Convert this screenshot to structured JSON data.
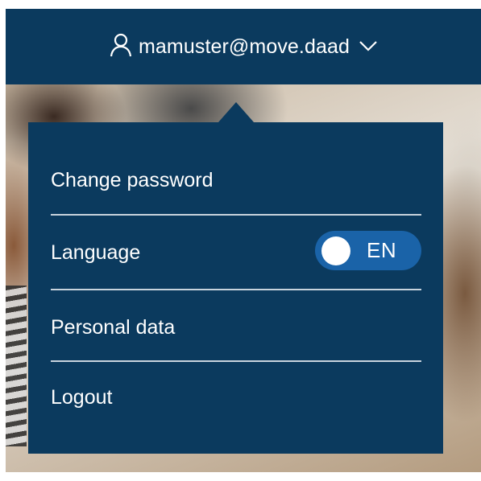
{
  "header": {
    "user_email": "mamuster@move.daad",
    "icons": {
      "user": "user-outline-icon",
      "chevron": "chevron-down-icon"
    }
  },
  "menu": {
    "items": [
      {
        "label": "Change password"
      },
      {
        "label": "Language",
        "toggle_value": "EN"
      },
      {
        "label": "Personal data"
      },
      {
        "label": "Logout"
      }
    ]
  },
  "colors": {
    "header_bg": "#0b3a5e",
    "menu_bg": "#0b3a5e",
    "toggle_bg": "#1a63a8",
    "divider": "#c8d3dd",
    "text": "#ffffff"
  }
}
